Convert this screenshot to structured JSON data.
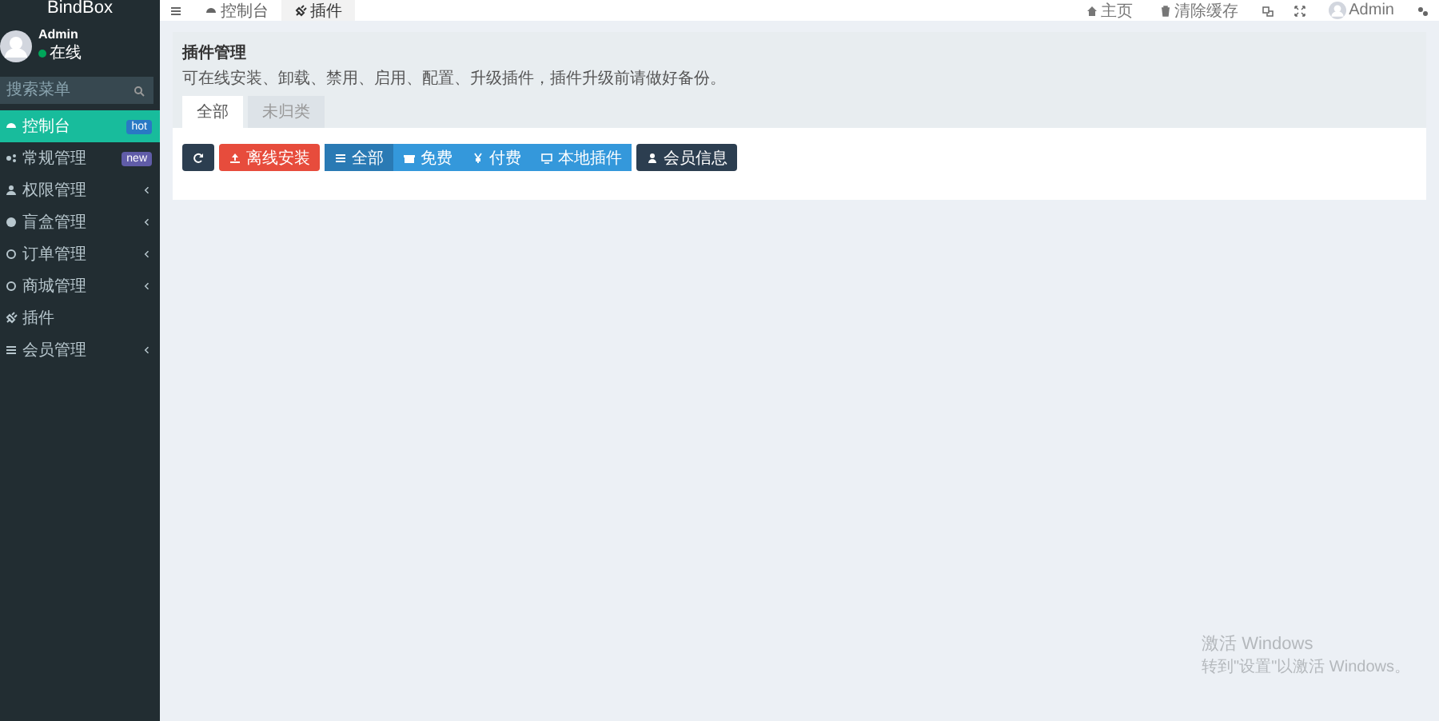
{
  "sidebar": {
    "logo": "BindBox",
    "user": {
      "name": "Admin",
      "status": "在线"
    },
    "search": {
      "placeholder": "搜索菜单"
    },
    "items": [
      {
        "label": "控制台",
        "selected": true,
        "badge": "hot",
        "color": "#2979c4",
        "expandable": false
      },
      {
        "label": "常规管理",
        "selected": false,
        "badge": "new",
        "color": "#605ca8",
        "expandable": false
      },
      {
        "label": "权限管理",
        "selected": false,
        "expandable": true
      },
      {
        "label": "盲盒管理",
        "selected": false,
        "expandable": true
      },
      {
        "label": "订单管理",
        "selected": false,
        "expandable": true
      },
      {
        "label": "商城管理",
        "selected": false,
        "expandable": true
      },
      {
        "label": "插件",
        "selected": false,
        "expandable": false
      },
      {
        "label": "会员管理",
        "selected": false,
        "expandable": true
      }
    ]
  },
  "topbar": {
    "tabs": [
      {
        "label": "控制台",
        "selected": false
      },
      {
        "label": "插件",
        "selected": true
      }
    ],
    "right": [
      "主页",
      "清除缓存"
    ],
    "user": "Admin"
  },
  "panel": {
    "title": "插件管理",
    "description": "可在线安装、卸载、禁用、启用、配置、升级插件，插件升级前请做好备份。",
    "tabs": [
      {
        "label": "全部",
        "selected": true
      },
      {
        "label": "未归类",
        "selected": false
      }
    ],
    "buttons": [
      {
        "kind": "refresh"
      },
      {
        "kind": "danger",
        "label": "离线安装"
      },
      {
        "kind": "group",
        "label": "全部",
        "selected": true
      },
      {
        "kind": "group",
        "label": "免费",
        "selected": false
      },
      {
        "kind": "group",
        "label": "付费",
        "selected": false
      },
      {
        "kind": "group",
        "label": "本地插件",
        "selected": false
      },
      {
        "kind": "dark",
        "label": "会员信息"
      }
    ]
  },
  "activation": {
    "title": "激活 Windows",
    "text": "转到\"设置\"以激活 Windows。"
  }
}
